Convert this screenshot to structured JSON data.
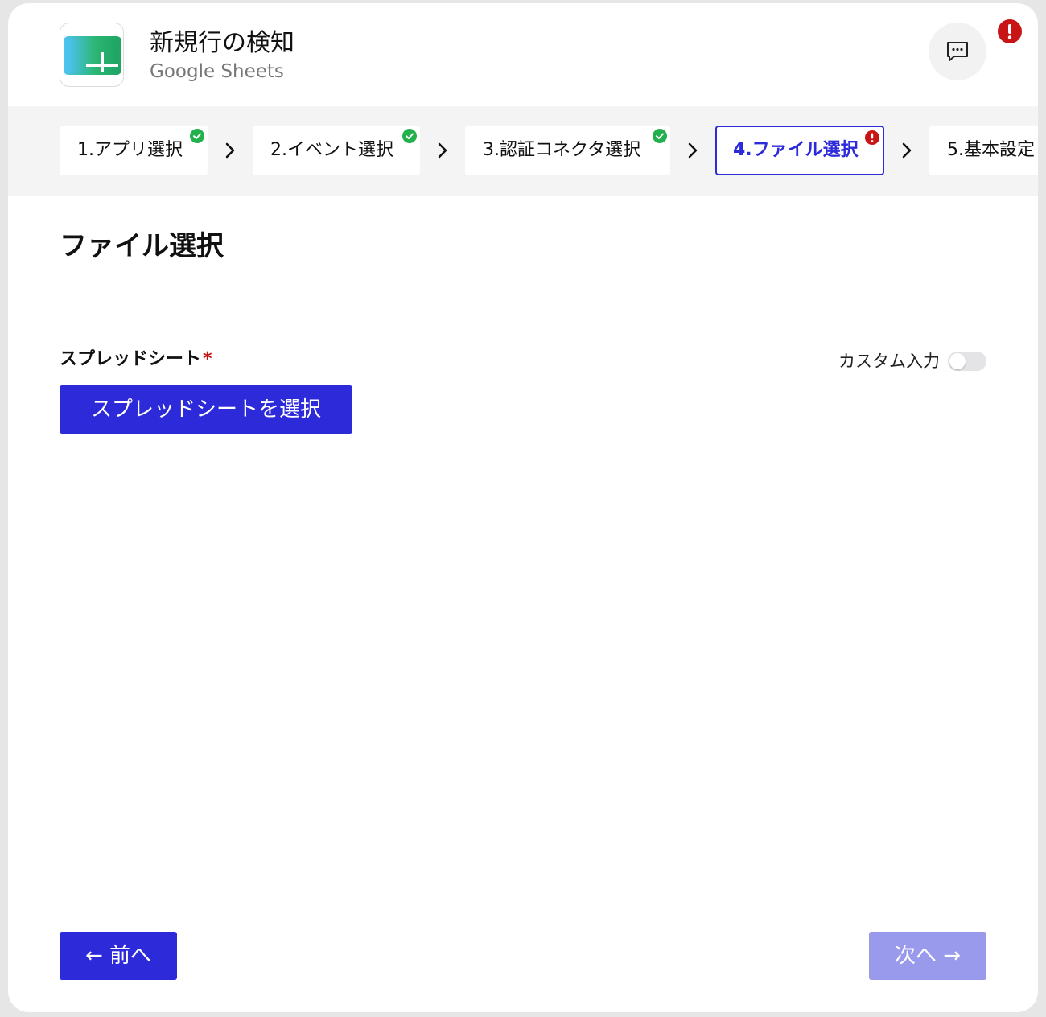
{
  "header": {
    "title": "新規行の検知",
    "subtitle": "Google Sheets",
    "logo_icon": "google-sheets-logo",
    "chat_icon": "chat-bubble-icon",
    "alert_icon": "exclamation-icon",
    "colors": {
      "logo_green": "#1fa463",
      "logo_blue": "#4fc3f7",
      "alert_red": "#c81414"
    }
  },
  "stepper": {
    "steps": [
      {
        "label": "1.アプリ選択",
        "status": "complete"
      },
      {
        "label": "2.イベント選択",
        "status": "complete"
      },
      {
        "label": "3.認証コネクタ選択",
        "status": "complete"
      },
      {
        "label": "4.ファイル選択",
        "status": "error"
      },
      {
        "label": "5.基本設定",
        "status": "pending"
      }
    ],
    "active_step": 4,
    "colors": {
      "complete": "#22b14c",
      "error": "#c81414",
      "active": "#2d2bd9"
    }
  },
  "main": {
    "section_title": "ファイル選択",
    "field_label": "スプレッドシート",
    "required_mark": "*",
    "custom_input_label": "カスタム入力",
    "custom_input_on": false,
    "select_button_label": "スプレッドシートを選択"
  },
  "footer": {
    "prev_label": "← 前へ",
    "next_label": "次へ →",
    "next_disabled": true
  },
  "colors": {
    "primary": "#2d2bd9",
    "primary_disabled": "#9a9aec",
    "stepper_bg": "#f4f4f5"
  }
}
